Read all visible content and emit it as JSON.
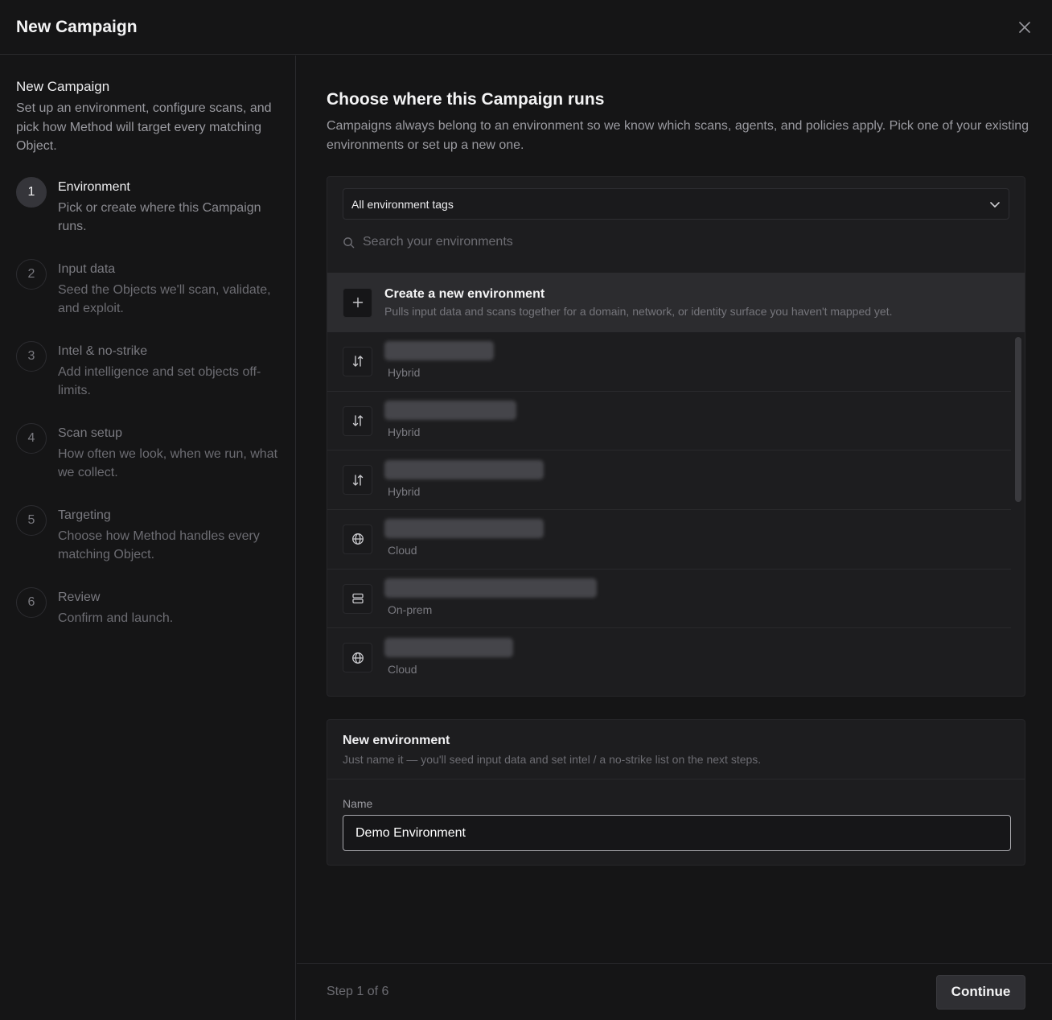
{
  "header": {
    "title": "New Campaign",
    "close_icon": "close-icon"
  },
  "sidebar": {
    "title": "New Campaign",
    "description": "Set up an environment, configure scans, and pick how Method will target every matching Object.",
    "steps": [
      {
        "number": "1",
        "title": "Environment",
        "description": "Pick or create where this Campaign runs.",
        "active": true
      },
      {
        "number": "2",
        "title": "Input data",
        "description": "Seed the Objects we'll scan, validate, and exploit.",
        "active": false
      },
      {
        "number": "3",
        "title": "Intel & no-strike",
        "description": "Add intelligence and set objects off-limits.",
        "active": false
      },
      {
        "number": "4",
        "title": "Scan setup",
        "description": "How often we look, when we run, what we collect.",
        "active": false
      },
      {
        "number": "5",
        "title": "Targeting",
        "description": "Choose how Method handles every matching Object.",
        "active": false
      },
      {
        "number": "6",
        "title": "Review",
        "description": "Confirm and launch.",
        "active": false
      }
    ]
  },
  "main": {
    "title": "Choose where this Campaign runs",
    "description": "Campaigns always belong to an environment so we know which scans, agents, and policies apply. Pick one of your existing environments or set up a new one.",
    "tag_filter": {
      "selected": "All environment tags",
      "icon": "chevron-down-icon"
    },
    "search": {
      "placeholder": "Search your environments",
      "value": "",
      "icon": "search-icon"
    },
    "create": {
      "title": "Create a new environment",
      "description": "Pulls input data and scans together for a domain, network, or identity surface you haven't mapped yet.",
      "icon": "plus-icon"
    },
    "environments": [
      {
        "type": "Hybrid",
        "icon": "sync-arrows-icon"
      },
      {
        "type": "Hybrid",
        "icon": "sync-arrows-icon"
      },
      {
        "type": "Hybrid",
        "icon": "sync-arrows-icon"
      },
      {
        "type": "Cloud",
        "icon": "globe-icon"
      },
      {
        "type": "On-prem",
        "icon": "server-icon"
      },
      {
        "type": "Cloud",
        "icon": "globe-icon"
      }
    ],
    "new_environment": {
      "title": "New environment",
      "description": "Just name it — you'll seed input data and set intel / a no-strike list on the next steps.",
      "name_label": "Name",
      "name_value": "Demo Environment"
    }
  },
  "footer": {
    "step_text": "Step 1 of 6",
    "continue_label": "Continue"
  }
}
